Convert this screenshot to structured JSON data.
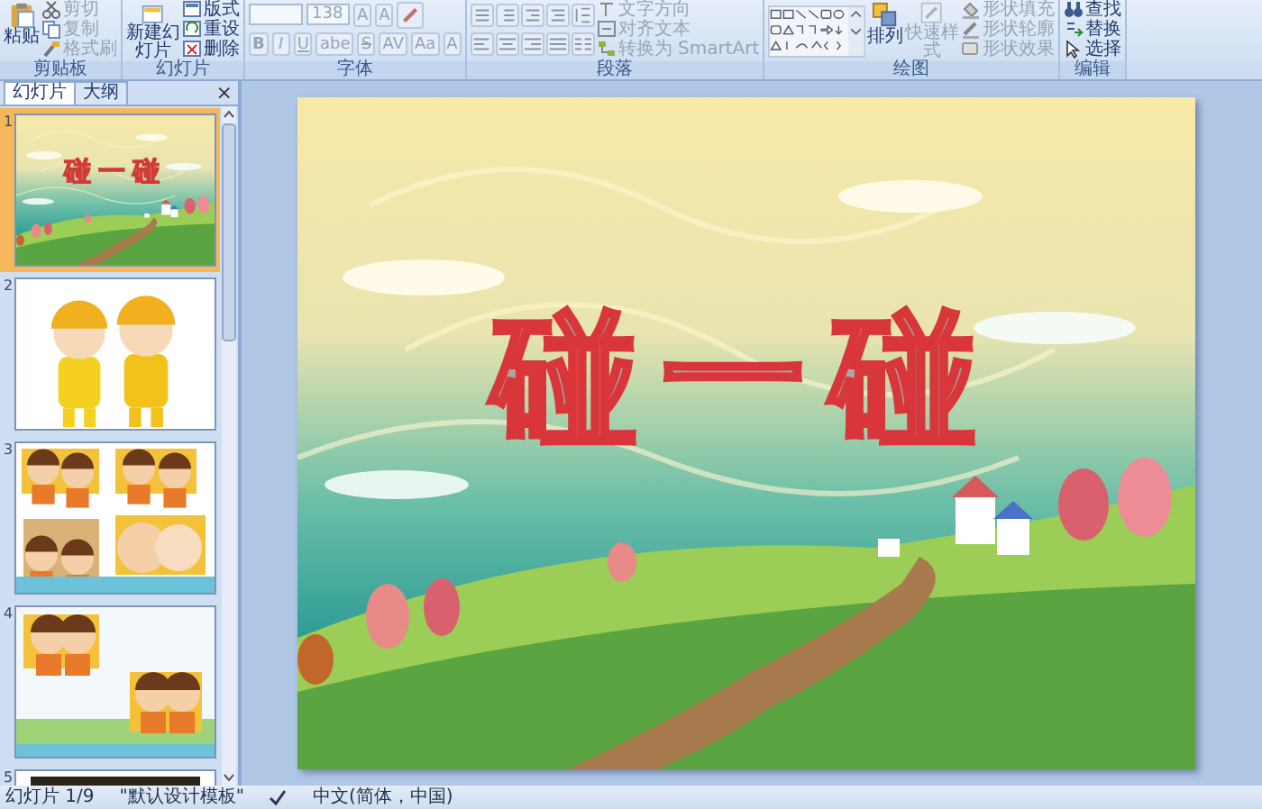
{
  "ribbon": {
    "groups": [
      {
        "kind": "clipboard",
        "label": "剪贴板",
        "items": [
          {
            "kind": "large",
            "label": "粘贴",
            "disabled": false
          },
          {
            "kind": "small",
            "label": "剪切",
            "disabled": true
          },
          {
            "kind": "small",
            "label": "复制",
            "disabled": true
          },
          {
            "kind": "small",
            "label": "格式刷",
            "disabled": true
          }
        ]
      },
      {
        "kind": "slides",
        "label": "幻灯片",
        "items": [
          {
            "kind": "large",
            "label": "新建幻灯片",
            "disabled": false
          },
          {
            "kind": "small",
            "label": "版式",
            "disabled": false
          },
          {
            "kind": "small",
            "label": "重设",
            "disabled": false
          },
          {
            "kind": "small",
            "label": "删除",
            "disabled": false
          }
        ]
      },
      {
        "kind": "font",
        "label": "字体",
        "disabled": true,
        "font_size": "138",
        "glyphs": [
          "A",
          "A",
          "B",
          "I",
          "U",
          "abe",
          "S",
          "AV",
          "Aa",
          "A"
        ]
      },
      {
        "kind": "paragraph",
        "label": "段落",
        "items": [
          {
            "kind": "small",
            "label": "文字方向",
            "disabled": true
          },
          {
            "kind": "small",
            "label": "对齐文本",
            "disabled": true
          },
          {
            "kind": "small",
            "label": "转换为 SmartArt",
            "disabled": true
          }
        ]
      },
      {
        "kind": "drawing",
        "label": "绘图",
        "items": [
          {
            "kind": "large",
            "label": "排列",
            "disabled": false
          },
          {
            "kind": "large",
            "label": "快速样式",
            "disabled": true
          },
          {
            "kind": "small",
            "label": "形状填充",
            "disabled": true
          },
          {
            "kind": "small",
            "label": "形状轮廓",
            "disabled": true
          },
          {
            "kind": "small",
            "label": "形状效果",
            "disabled": true
          }
        ]
      },
      {
        "kind": "editing",
        "label": "编辑",
        "items": [
          {
            "kind": "small",
            "label": "查找",
            "disabled": false
          },
          {
            "kind": "small",
            "label": "替换",
            "disabled": false
          },
          {
            "kind": "small",
            "label": "选择",
            "disabled": false
          }
        ]
      }
    ]
  },
  "sidebar": {
    "tabs": [
      {
        "label": "幻灯片",
        "selected": true
      },
      {
        "label": "大纲",
        "selected": false
      }
    ],
    "close": "×",
    "slides": [
      {
        "number": "1",
        "selected": true,
        "kind": "title",
        "title": "碰一碰"
      },
      {
        "number": "2",
        "selected": false,
        "kind": "kids"
      },
      {
        "number": "3",
        "selected": false,
        "kind": "grid"
      },
      {
        "number": "4",
        "selected": false,
        "kind": "pair"
      },
      {
        "number": "5",
        "selected": false
      }
    ]
  },
  "slide": {
    "title": "碰一碰"
  },
  "status_bar": {
    "slide": "幻灯片 1/9",
    "theme": "\"默认设计模板\"",
    "language": "中文(简体，中国)"
  }
}
